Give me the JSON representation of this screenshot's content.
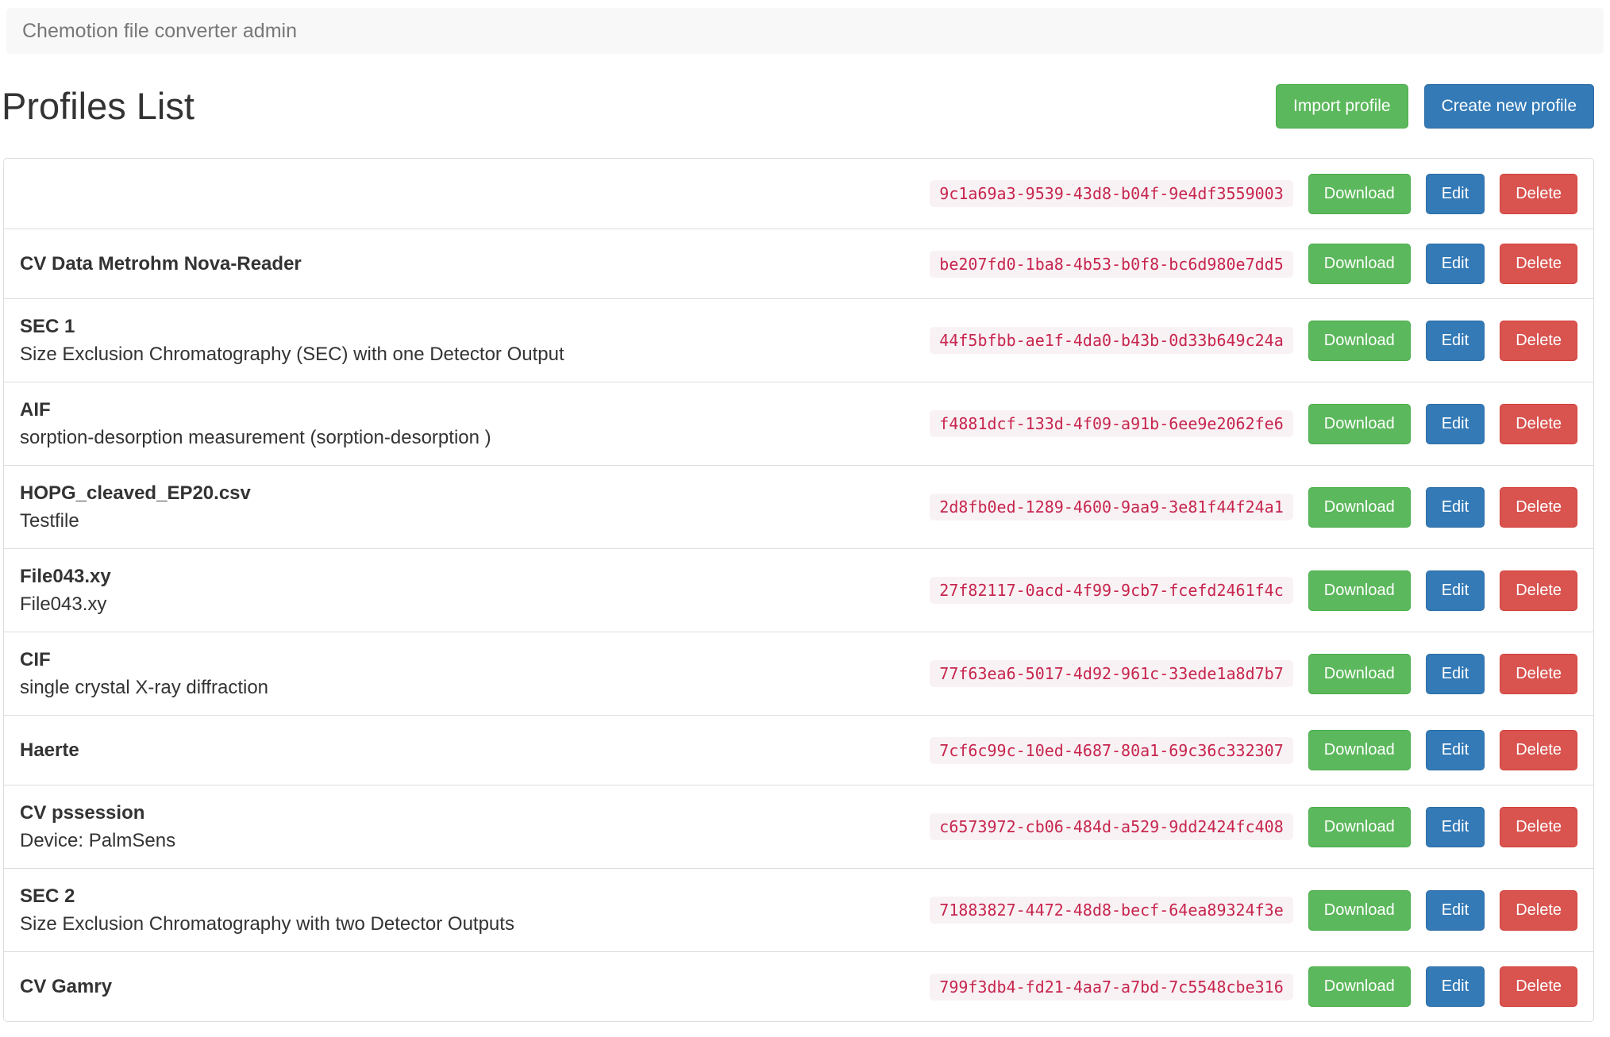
{
  "navbar": {
    "brand": "Chemotion file converter admin"
  },
  "header": {
    "title": "Profiles List",
    "import_label": "Import profile",
    "create_label": "Create new profile"
  },
  "actions": {
    "download": "Download",
    "edit": "Edit",
    "delete": "Delete"
  },
  "colors": {
    "success_green": "#5cb85c",
    "primary_blue": "#337ab7",
    "danger_red": "#d9534f",
    "code_text": "#c7254e",
    "code_background": "#f9f2f4",
    "navbar_background": "#f8f8f8",
    "navbar_text": "#777777",
    "border": "#dddddd"
  },
  "profiles": [
    {
      "title": "",
      "description": "",
      "id": "9c1a69a3-9539-43d8-b04f-9e4df3559003"
    },
    {
      "title": "CV Data Metrohm Nova-Reader",
      "description": "",
      "id": "be207fd0-1ba8-4b53-b0f8-bc6d980e7dd5"
    },
    {
      "title": "SEC 1",
      "description": "Size Exclusion Chromatography (SEC) with one Detector Output",
      "id": "44f5bfbb-ae1f-4da0-b43b-0d33b649c24a"
    },
    {
      "title": "AIF",
      "description": "sorption-desorption measurement (sorption-desorption )",
      "id": "f4881dcf-133d-4f09-a91b-6ee9e2062fe6"
    },
    {
      "title": "HOPG_cleaved_EP20.csv",
      "description": "Testfile",
      "id": "2d8fb0ed-1289-4600-9aa9-3e81f44f24a1"
    },
    {
      "title": "File043.xy",
      "description": "File043.xy",
      "id": "27f82117-0acd-4f99-9cb7-fcefd2461f4c"
    },
    {
      "title": "CIF",
      "description": "single crystal X-ray diffraction",
      "id": "77f63ea6-5017-4d92-961c-33ede1a8d7b7"
    },
    {
      "title": "Haerte",
      "description": "",
      "id": "7cf6c99c-10ed-4687-80a1-69c36c332307"
    },
    {
      "title": "CV pssession",
      "description": "Device: PalmSens",
      "id": "c6573972-cb06-484d-a529-9dd2424fc408"
    },
    {
      "title": "SEC 2",
      "description": "Size Exclusion Chromatography with two Detector Outputs",
      "id": "71883827-4472-48d8-becf-64ea89324f3e"
    },
    {
      "title": "CV Gamry",
      "description": "",
      "id": "799f3db4-fd21-4aa7-a7bd-7c5548cbe316"
    }
  ]
}
